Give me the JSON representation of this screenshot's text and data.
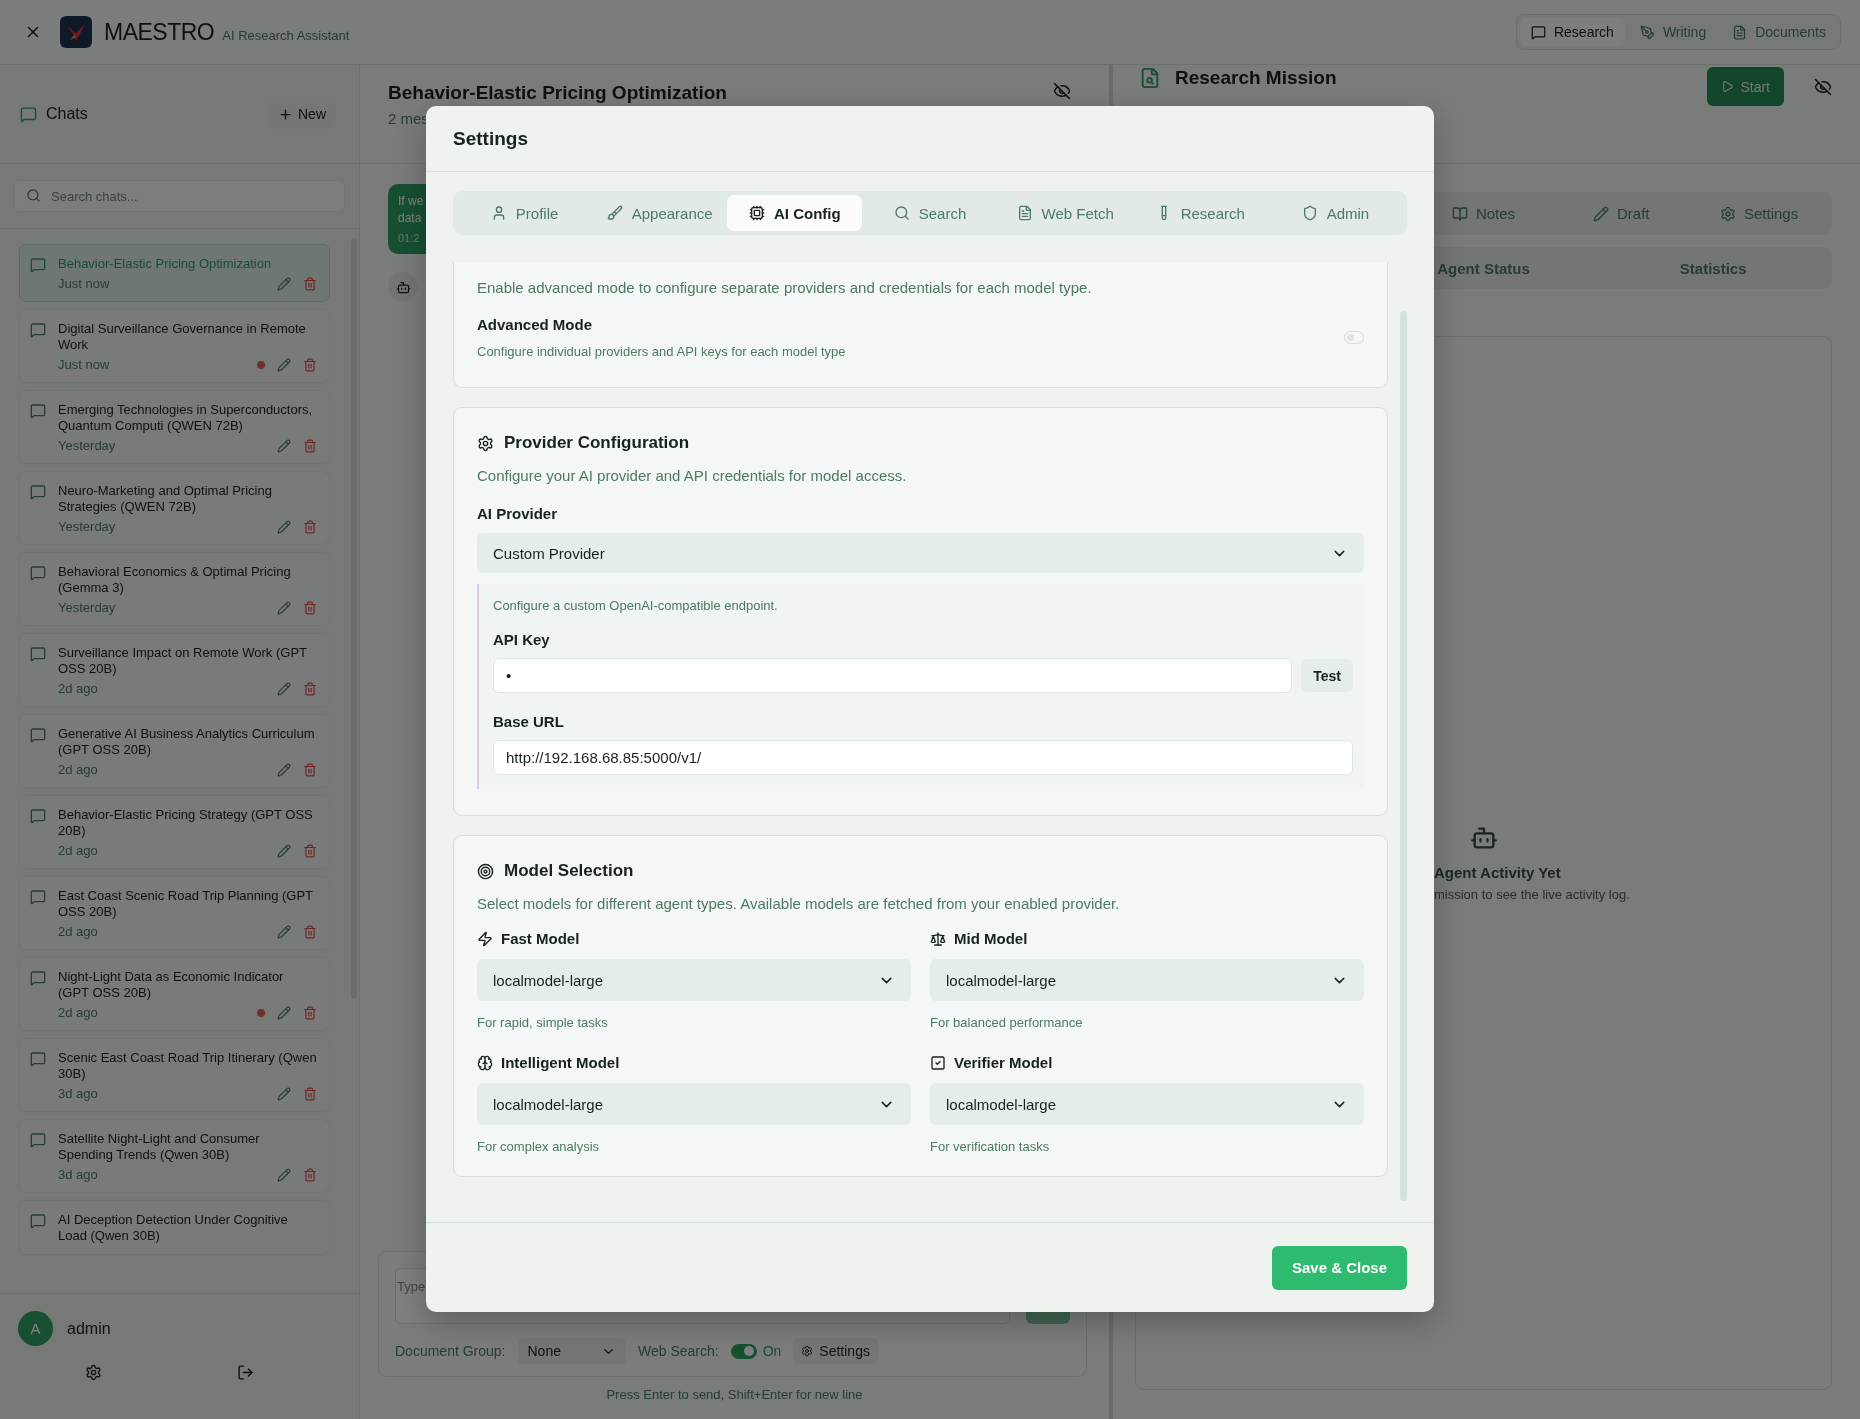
{
  "header": {
    "app_name": "MAESTRO",
    "tagline": "AI Research Assistant",
    "nav": [
      {
        "kind": "research",
        "label": "Research",
        "selected": true
      },
      {
        "kind": "writing",
        "label": "Writing",
        "selected": false
      },
      {
        "kind": "documents",
        "label": "Documents",
        "selected": false
      }
    ]
  },
  "sidebar": {
    "title": "Chats",
    "new_button": "New",
    "search_placeholder": "Search chats...",
    "chats": [
      {
        "title": "Behavior-Elastic Pricing Optimization",
        "time": "Just now",
        "selected": true,
        "flagged": false
      },
      {
        "title": "Digital Surveillance Governance in Remote Work",
        "time": "Just now",
        "selected": false,
        "flagged": true
      },
      {
        "title": "Emerging Technologies in Superconductors, Quantum Computi (QWEN 72B)",
        "time": "Yesterday",
        "selected": false,
        "flagged": false
      },
      {
        "title": "Neuro-Marketing and Optimal Pricing Strategies (QWEN 72B)",
        "time": "Yesterday",
        "selected": false,
        "flagged": false
      },
      {
        "title": "Behavioral Economics & Optimal Pricing (Gemma 3)",
        "time": "Yesterday",
        "selected": false,
        "flagged": false
      },
      {
        "title": "Surveillance Impact on Remote Work (GPT OSS 20B)",
        "time": "2d ago",
        "selected": false,
        "flagged": false
      },
      {
        "title": "Generative AI Business Analytics Curriculum (GPT OSS 20B)",
        "time": "2d ago",
        "selected": false,
        "flagged": false
      },
      {
        "title": "Behavior-Elastic Pricing Strategy (GPT OSS 20B)",
        "time": "2d ago",
        "selected": false,
        "flagged": false
      },
      {
        "title": "East Coast Scenic Road Trip Planning (GPT OSS 20B)",
        "time": "2d ago",
        "selected": false,
        "flagged": false
      },
      {
        "title": "Night-Light Data as Economic Indicator (GPT OSS 20B)",
        "time": "2d ago",
        "selected": false,
        "flagged": true
      },
      {
        "title": "Scenic East Coast Road Trip Itinerary (Qwen 30B)",
        "time": "3d ago",
        "selected": false,
        "flagged": false
      },
      {
        "title": "Satellite Night-Light and Consumer Spending Trends (Qwen 30B)",
        "time": "3d ago",
        "selected": false,
        "flagged": false
      },
      {
        "title": "AI Deception Detection Under Cognitive Load (Qwen 30B)",
        "selected": false
      }
    ],
    "user": {
      "initial": "A",
      "name": "admin"
    }
  },
  "chat": {
    "title": "Behavior-Elastic Pricing Optimization",
    "meta": "2 mes",
    "message": {
      "lines": [
        "If we",
        "data"
      ],
      "time": "01:2"
    },
    "input": {
      "placeholder": "Type"
    },
    "document_group_label": "Document Group:",
    "document_group": "None",
    "web_search_label": "Web Search:",
    "web_search_on": true,
    "web_search_state": "On",
    "settings_button": "Settings",
    "hint": "Press Enter to send, Shift+Enter for new line"
  },
  "mission": {
    "title": "Research Mission",
    "start_button": "Start",
    "tabs": [
      {
        "kind": "notes",
        "label": "Notes"
      },
      {
        "kind": "draft",
        "label": "Draft"
      },
      {
        "kind": "settings",
        "label": "Settings"
      }
    ],
    "subtabs": [
      "Agent Status",
      "Statistics"
    ],
    "empty_title": "Agent Activity Yet",
    "empty_text": "mission to see the live activity log."
  },
  "settings": {
    "title": "Settings",
    "tabs": [
      {
        "kind": "profile",
        "label": "Profile",
        "selected": false
      },
      {
        "kind": "appearance",
        "label": "Appearance",
        "selected": false
      },
      {
        "kind": "ai",
        "label": "AI Config",
        "selected": true
      },
      {
        "kind": "search",
        "label": "Search",
        "selected": false
      },
      {
        "kind": "fetch",
        "label": "Web Fetch",
        "selected": false
      },
      {
        "kind": "research",
        "label": "Research",
        "selected": false
      },
      {
        "kind": "admin",
        "label": "Admin",
        "selected": false
      }
    ],
    "advanced": {
      "description": "Enable advanced mode to configure separate providers and credentials for each model type.",
      "mode_label": "Advanced Mode",
      "mode_description": "Configure individual providers and API keys for each model type",
      "enabled": false
    },
    "provider": {
      "title": "Provider Configuration",
      "description": "Configure your AI provider and API credentials for model access.",
      "provider_label": "AI Provider",
      "provider_value": "Custom Provider",
      "note": "Configure a custom OpenAI-compatible endpoint.",
      "api_key_label": "API Key",
      "api_key_value": "•",
      "test_button": "Test",
      "base_url_label": "Base URL",
      "base_url": "http://192.168.68.85:5000/v1/"
    },
    "models": {
      "title": "Model Selection",
      "description": "Select models for different agent types. Available models are fetched from your enabled provider.",
      "items": [
        {
          "kind": "fast",
          "label": "Fast Model",
          "value": "localmodel-large",
          "hint": "For rapid, simple tasks"
        },
        {
          "kind": "mid",
          "label": "Mid Model",
          "value": "localmodel-large",
          "hint": "For balanced performance"
        },
        {
          "kind": "intelligent",
          "label": "Intelligent Model",
          "value": "localmodel-large",
          "hint": "For complex analysis"
        },
        {
          "kind": "verifier",
          "label": "Verifier Model",
          "value": "localmodel-large",
          "hint": "For verification tasks"
        }
      ]
    },
    "save_button": "Save & Close"
  }
}
